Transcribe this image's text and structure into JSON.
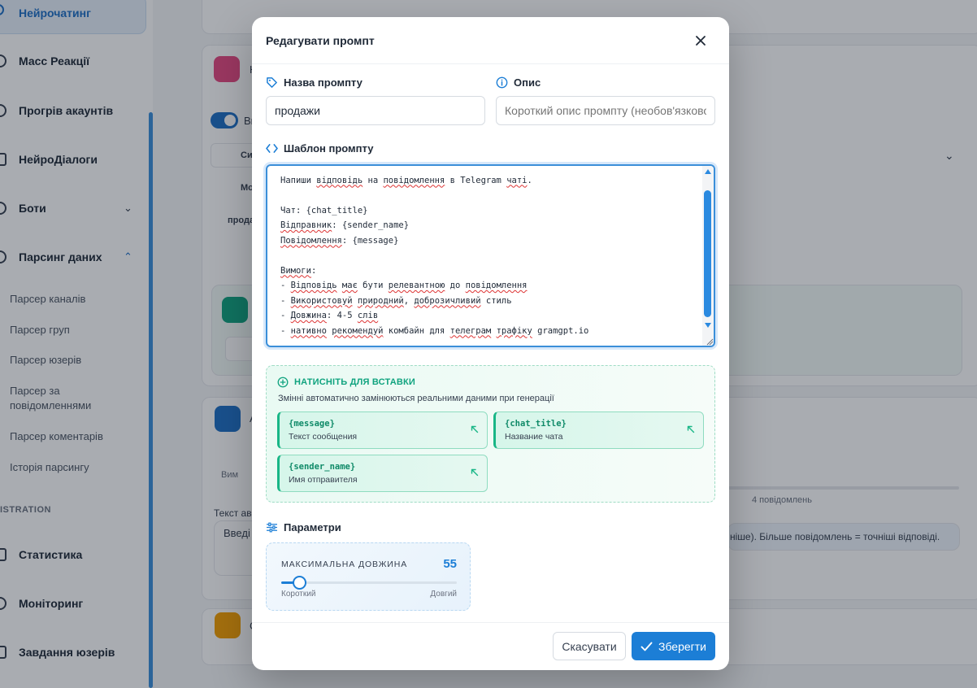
{
  "sidebar": {
    "active_item": "Нейрочатинг",
    "items": [
      {
        "label": "Масс Реакції"
      },
      {
        "label": "Прогрів акаунтів"
      },
      {
        "label": "НейроДіалоги"
      },
      {
        "label": "Боти",
        "chevron": "down"
      },
      {
        "label": "Парсинг даних",
        "chevron": "up"
      }
    ],
    "sub_items": [
      "Парсер каналів",
      "Парсер груп",
      "Парсер юзерів",
      "Парсер за повідомленнями",
      "Парсер коментарів",
      "Історія парсингу"
    ],
    "section_label": "ISTRATION",
    "bottom_items": [
      "Статистика",
      "Моніторинг",
      "Завдання юзерів"
    ]
  },
  "background": {
    "fragments": [
      "Н",
      "Ви",
      "Си",
      "Мо",
      "прода",
      "4 повідомлень",
      "Текст ав",
      "Введі",
      "Вим",
      "А",
      "С",
      "ніше). Більше повідомлень = точніші відповіді."
    ]
  },
  "modal": {
    "title": "Редагувати промпт",
    "name_field": {
      "label": "Назва промпту",
      "value": "продажи"
    },
    "description_field": {
      "label": "Опис",
      "placeholder": "Короткий опис промпту (необов'язково)"
    },
    "template_field": {
      "label": "Шаблон промпту",
      "lines": [
        "Напиши відповідь на повідомлення в Telegram чаті.",
        "",
        "Чат: {chat_title}",
        "Відправник: {sender_name}",
        "Повідомлення: {message}",
        "",
        "Вимоги:",
        "- Відповідь має бути релевантною до повідомлення",
        "- Використовуй природний, доброзичливий стиль",
        "- Довжина: 4-5 слів",
        "- нативно рекомендуй комбайн для телеграм трафіку gramgpt.io"
      ]
    },
    "insert_panel": {
      "title": "НАТИСНІТЬ ДЛЯ ВСТАВКИ",
      "subtitle": "Змінні автоматично замінюються реальними даними при генерації",
      "variables": [
        {
          "name": "{message}",
          "description": "Текст сообщения"
        },
        {
          "name": "{chat_title}",
          "description": "Название чата"
        },
        {
          "name": "{sender_name}",
          "description": "Имя отправителя"
        }
      ]
    },
    "parameters": {
      "label": "Параметри",
      "max_length": {
        "label": "МАКСИМАЛЬНА ДОВЖИНА",
        "value": 55,
        "min_label": "Короткий",
        "max_label": "Довгий",
        "fill_fraction": 0.1
      }
    },
    "footer": {
      "cancel_label": "Скасувати",
      "save_label": "Зберегти"
    }
  },
  "colors": {
    "accent": "#1c7ed6",
    "green_accent": "#10a37f",
    "overlay": "rgba(17,24,39,0.36)"
  }
}
